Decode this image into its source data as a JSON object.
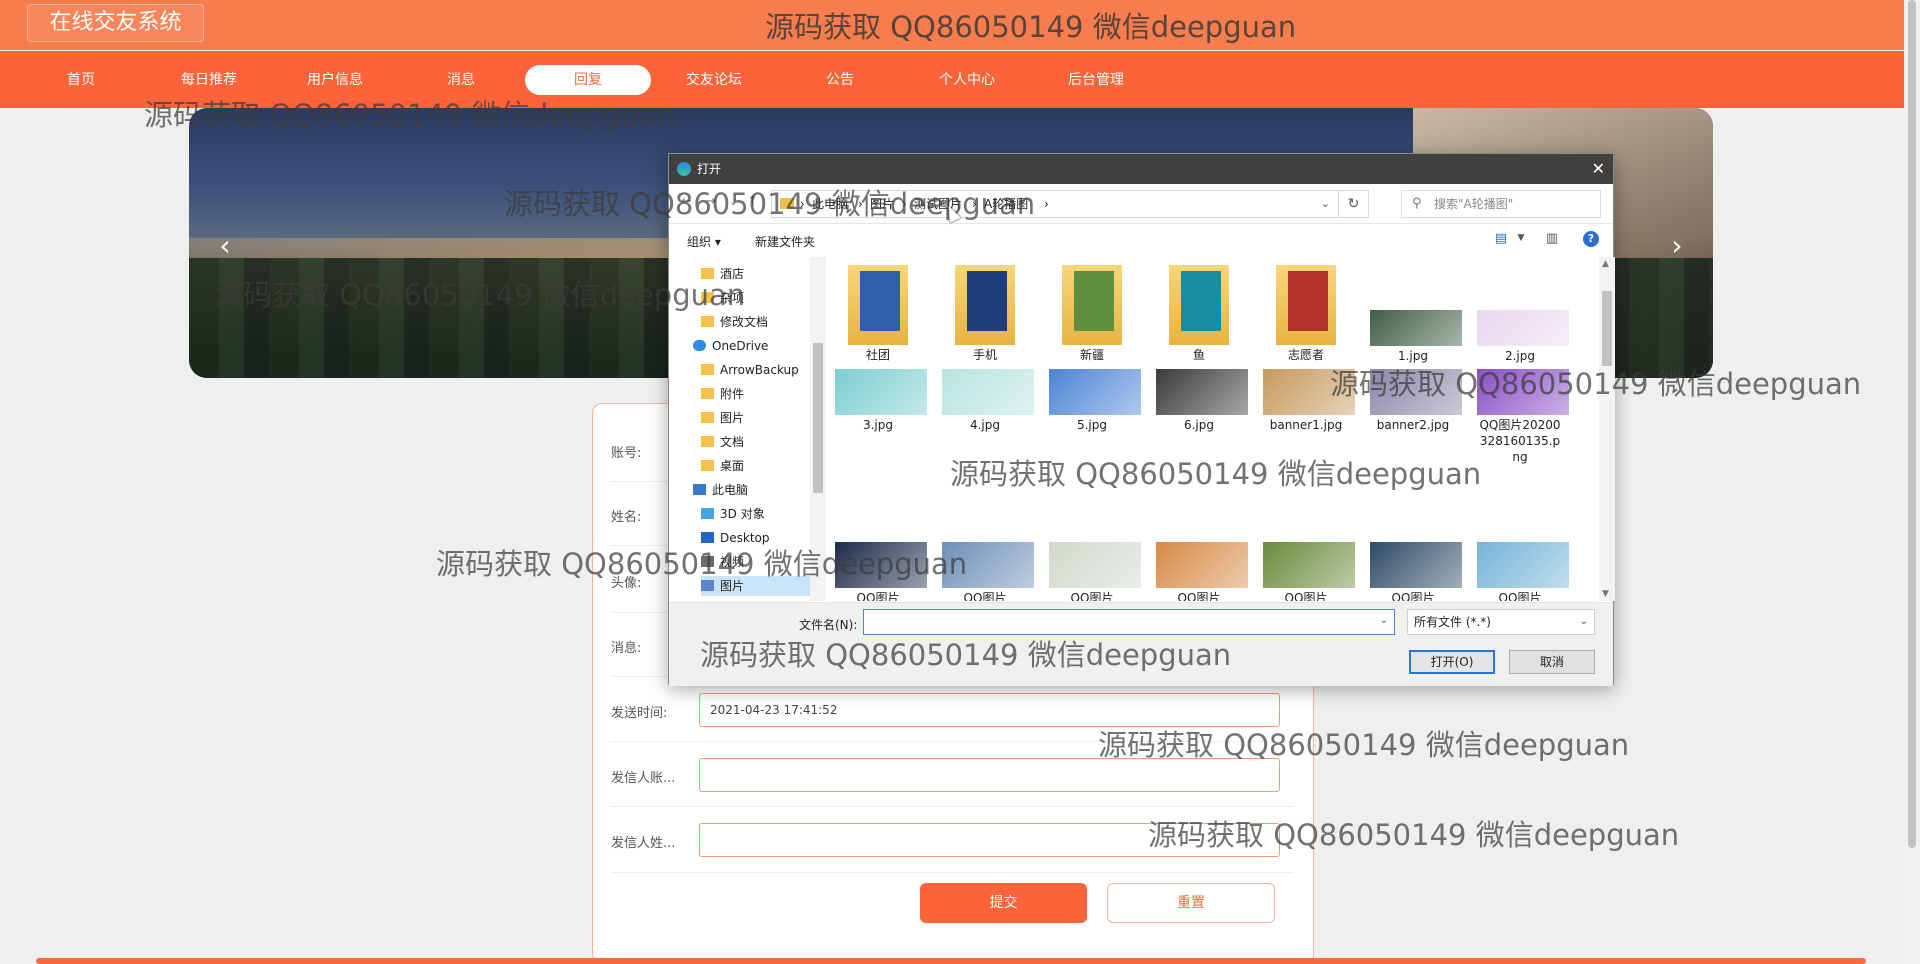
{
  "header": {
    "logo": "在线交友系统",
    "watermark": "源码获取 QQ86050149 微信deepguan"
  },
  "nav": [
    {
      "label": "首页",
      "active": false
    },
    {
      "label": "每日推荐",
      "active": false
    },
    {
      "label": "用户信息",
      "active": false
    },
    {
      "label": "消息",
      "active": false
    },
    {
      "label": "回复",
      "active": true
    },
    {
      "label": "交友论坛",
      "active": false
    },
    {
      "label": "公告",
      "active": false
    },
    {
      "label": "个人中心",
      "active": false
    },
    {
      "label": "后台管理",
      "active": false
    }
  ],
  "banner": {
    "prev_icon": "‹",
    "next_icon": "›"
  },
  "form": {
    "rows": [
      {
        "label": "账号:",
        "value": ""
      },
      {
        "label": "姓名:",
        "value": ""
      },
      {
        "label": "头像:",
        "value": ""
      },
      {
        "label": "消息:",
        "value": ""
      },
      {
        "label": "发送时间:",
        "value": "2021-04-23 17:41:52"
      },
      {
        "label": "发信人账...",
        "value": ""
      },
      {
        "label": "发信人姓...",
        "value": ""
      }
    ],
    "submit": "提交",
    "reset": "重置"
  },
  "dialog": {
    "title": "打开",
    "close": "✕",
    "breadcrumb": [
      "此电脑",
      "图片",
      "测试图片",
      "A轮播图"
    ],
    "search_placeholder": "搜索\"A轮播图\"",
    "toolbar": {
      "organize": "组织 ▾",
      "new_folder": "新建文件夹",
      "help": "?"
    },
    "tree": [
      {
        "label": "酒店",
        "icon": "folder"
      },
      {
        "label": "杂项",
        "icon": "folder"
      },
      {
        "label": "修改文档",
        "icon": "folder"
      },
      {
        "label": "OneDrive",
        "icon": "cloud"
      },
      {
        "label": "ArrowBackup",
        "icon": "folder"
      },
      {
        "label": "附件",
        "icon": "folder"
      },
      {
        "label": "图片",
        "icon": "folder"
      },
      {
        "label": "文档",
        "icon": "folder"
      },
      {
        "label": "桌面",
        "icon": "folder"
      },
      {
        "label": "此电脑",
        "icon": "pc"
      },
      {
        "label": "3D 对象",
        "icon": "3d"
      },
      {
        "label": "Desktop",
        "icon": "desk"
      },
      {
        "label": "视频",
        "icon": "video"
      },
      {
        "label": "图片",
        "icon": "pic"
      }
    ],
    "files": [
      {
        "name": "社团",
        "kind": "folder",
        "color": "#2f5fa8"
      },
      {
        "name": "手机",
        "kind": "folder",
        "color": "#1f3d78"
      },
      {
        "name": "新疆",
        "kind": "folder",
        "color": "#5e8f3c"
      },
      {
        "name": "鱼",
        "kind": "folder",
        "color": "#1a8ca0"
      },
      {
        "name": "志愿者",
        "kind": "folder",
        "color": "#b0322a"
      },
      {
        "name": "1.jpg",
        "kind": "image",
        "color": "#3f5d44"
      },
      {
        "name": "2.jpg",
        "kind": "image",
        "color": "#e9d9ee"
      },
      {
        "name": "3.jpg",
        "kind": "image",
        "color": "#7ccfd0"
      },
      {
        "name": "4.jpg",
        "kind": "image",
        "color": "#b7e4df"
      },
      {
        "name": "5.jpg",
        "kind": "image",
        "color": "#4b84d6"
      },
      {
        "name": "6.jpg",
        "kind": "image",
        "color": "#3a3a3a"
      },
      {
        "name": "banner1.jpg",
        "kind": "image",
        "color": "#c79a5e"
      },
      {
        "name": "banner2.jpg",
        "kind": "image",
        "color": "#8c86a8"
      },
      {
        "name": "QQ图片20200328160135.png",
        "kind": "image",
        "color": "#8a4fc4"
      },
      {
        "name": "QQ图片",
        "kind": "image",
        "color": "#1d2b4a"
      },
      {
        "name": "QQ图片",
        "kind": "image",
        "color": "#6d8fb8"
      },
      {
        "name": "QQ图片",
        "kind": "image",
        "color": "#cfd9cc"
      },
      {
        "name": "QQ图片",
        "kind": "image",
        "color": "#d78a45"
      },
      {
        "name": "QQ图片",
        "kind": "image",
        "color": "#6a8a3c"
      },
      {
        "name": "QQ图片",
        "kind": "image",
        "color": "#2f4b66"
      },
      {
        "name": "QQ图片",
        "kind": "image",
        "color": "#74b4d8"
      }
    ],
    "filename_label": "文件名(N):",
    "filename_value": "",
    "filetype": "所有文件 (*.*)",
    "open": "打开(O)",
    "cancel": "取消"
  }
}
